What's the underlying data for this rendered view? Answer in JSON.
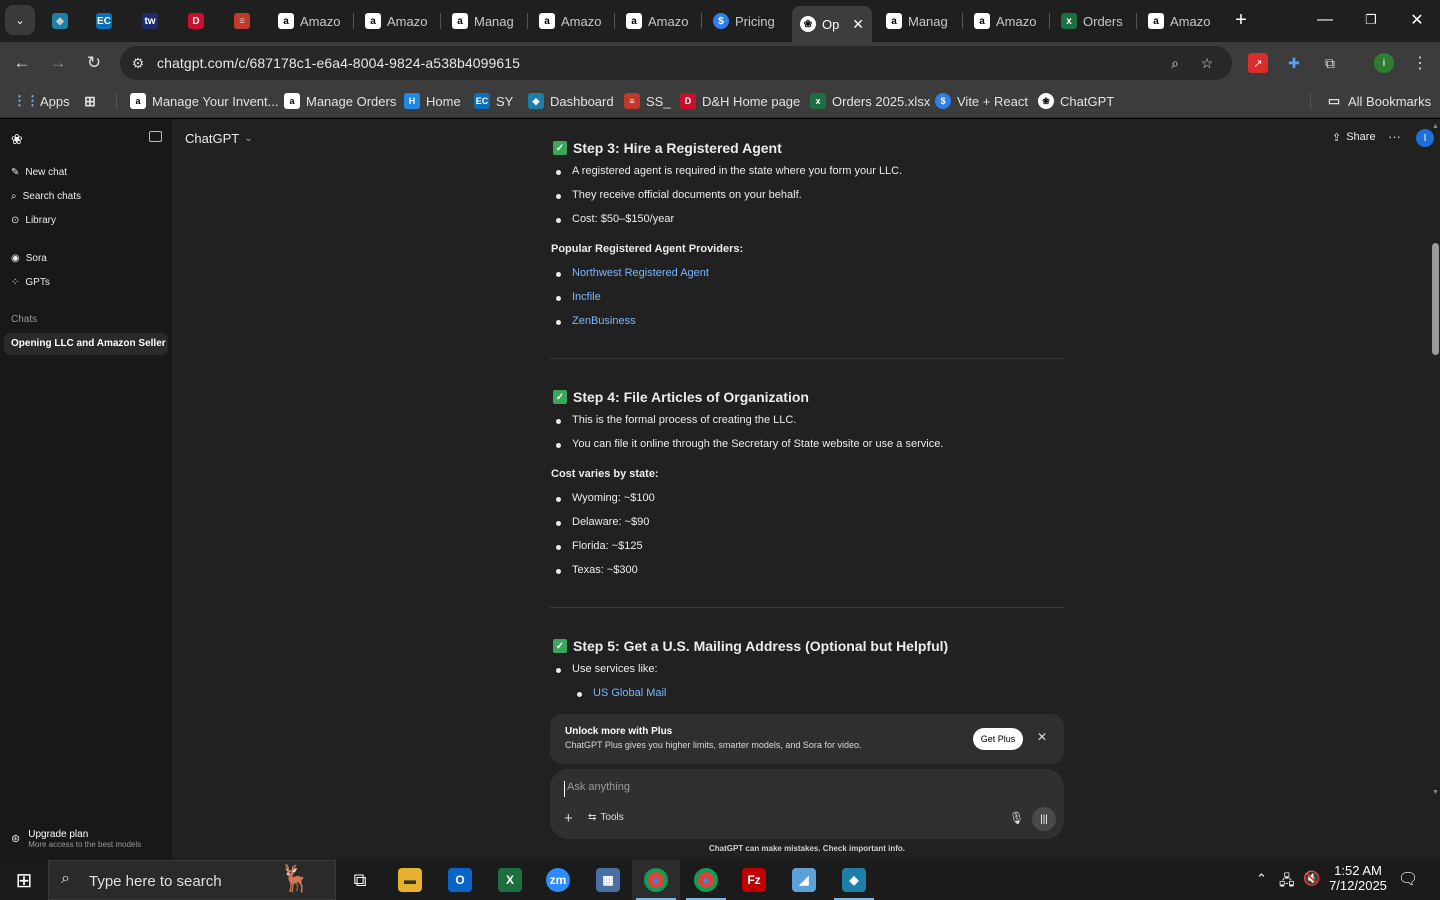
{
  "browser": {
    "tabs": [
      {
        "title": "",
        "icon": "tab-list-icon"
      },
      {
        "title": "",
        "icon": "diamond-icon"
      },
      {
        "title": "",
        "icon": "ec-icon"
      },
      {
        "title": "",
        "icon": "tw-icon"
      },
      {
        "title": "",
        "icon": "dh-icon"
      },
      {
        "title": "",
        "icon": "stack-icon"
      },
      {
        "title": "Amazo",
        "icon": "amazon-icon"
      },
      {
        "title": "Amazo",
        "icon": "amazon-icon"
      },
      {
        "title": "Manag",
        "icon": "amazon-icon"
      },
      {
        "title": "Amazo",
        "icon": "amazon-icon"
      },
      {
        "title": "Amazo",
        "icon": "amazon-icon"
      },
      {
        "title": "Pricing",
        "icon": "dollar-icon"
      },
      {
        "title": "Op",
        "icon": "openai-icon"
      },
      {
        "title": "Manag",
        "icon": "amazon-icon"
      },
      {
        "title": "Amazo",
        "icon": "amazon-icon"
      },
      {
        "title": "Orders",
        "icon": "excel-icon"
      },
      {
        "title": "Amazo",
        "icon": "amazon-icon"
      }
    ],
    "url": "chatgpt.com/c/687178c1-e6a4-8004-9824-a538b4099615",
    "bookmarks": [
      {
        "label": "Apps"
      },
      {
        "label": ""
      },
      {
        "label": "Manage Your Invent..."
      },
      {
        "label": "Manage Orders"
      },
      {
        "label": "Home"
      },
      {
        "label": "SY"
      },
      {
        "label": "Dashboard"
      },
      {
        "label": "SS_"
      },
      {
        "label": "D&H Home page"
      },
      {
        "label": "Orders 2025.xlsx"
      },
      {
        "label": "Vite + React"
      },
      {
        "label": "ChatGPT"
      }
    ],
    "all_bookmarks": "All Bookmarks"
  },
  "sidebar": {
    "items": [
      {
        "label": "New chat",
        "icon": "edit-icon"
      },
      {
        "label": "Search chats",
        "icon": "search-icon"
      },
      {
        "label": "Library",
        "icon": "library-icon"
      },
      {
        "label": "Sora",
        "icon": "sora-icon"
      },
      {
        "label": "GPTs",
        "icon": "grid-icon"
      }
    ],
    "chats_heading": "Chats",
    "active_chat": "Opening LLC and Amazon Seller",
    "upgrade_title": "Upgrade plan",
    "upgrade_sub": "More access to the best models"
  },
  "header": {
    "model": "ChatGPT",
    "share": "Share",
    "avatar_letter": "I"
  },
  "content": {
    "step3": {
      "title": "Step 3: Hire a Registered Agent",
      "bullets": [
        "A registered agent is required in the state where you form your LLC.",
        "They receive official documents on your behalf.",
        "Cost: $50–$150/year"
      ],
      "providers_heading": "Popular Registered Agent Providers:",
      "providers": [
        "Northwest Registered Agent",
        "Incfile",
        "ZenBusiness"
      ]
    },
    "step4": {
      "title": "Step 4: File Articles of Organization",
      "bullets": [
        "This is the formal process of creating the LLC.",
        "You can file it online through the Secretary of State website or use a service."
      ],
      "cost_heading": "Cost varies by state:",
      "costs": [
        "Wyoming: ~$100",
        "Delaware: ~$90",
        "Florida: ~$125",
        "Texas: ~$300"
      ]
    },
    "step5": {
      "title": "Step 5: Get a U.S. Mailing Address (Optional but Helpful)",
      "bullets": [
        "Use services like:"
      ],
      "services": [
        "US Global Mail"
      ]
    }
  },
  "promo": {
    "title": "Unlock more with Plus",
    "body": "ChatGPT Plus gives you higher limits, smarter models, and Sora for video.",
    "button": "Get Plus"
  },
  "composer": {
    "placeholder": "Ask anything",
    "tools": "Tools"
  },
  "disclaimer": "ChatGPT can make mistakes. Check important info.",
  "taskbar": {
    "search_placeholder": "Type here to search",
    "time": "1:52 AM",
    "date": "7/12/2025"
  },
  "colors": {
    "accent_check": "#3aa659",
    "link": "#7ab7ff",
    "avatar": "#1e6fd9"
  }
}
